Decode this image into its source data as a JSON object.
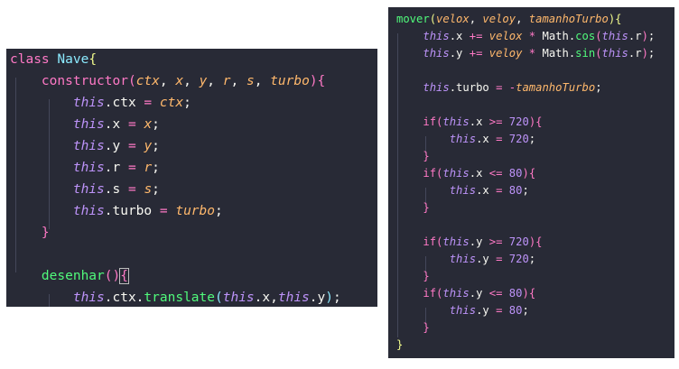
{
  "left_panel": {
    "lines": [
      [
        [
          "kw",
          "class"
        ],
        [
          "pn",
          " "
        ],
        [
          "cls",
          "Nave"
        ],
        [
          "br1",
          "{"
        ]
      ],
      [
        [
          "pn",
          "    "
        ],
        [
          "fnk",
          "constructor"
        ],
        [
          "br2",
          "("
        ],
        [
          "prm",
          "ctx"
        ],
        [
          "pn",
          ", "
        ],
        [
          "prm",
          "x"
        ],
        [
          "pn",
          ", "
        ],
        [
          "prm",
          "y"
        ],
        [
          "pn",
          ", "
        ],
        [
          "prm",
          "r"
        ],
        [
          "pn",
          ", "
        ],
        [
          "prm",
          "s"
        ],
        [
          "pn",
          ", "
        ],
        [
          "prm",
          "turbo"
        ],
        [
          "br2",
          "){"
        ]
      ],
      [
        [
          "pn",
          "        "
        ],
        [
          "ths",
          "this"
        ],
        [
          "pn",
          ".ctx "
        ],
        [
          "op",
          "="
        ],
        [
          "pn",
          " "
        ],
        [
          "prm",
          "ctx"
        ],
        [
          "pn",
          ";"
        ]
      ],
      [
        [
          "pn",
          "        "
        ],
        [
          "ths",
          "this"
        ],
        [
          "pn",
          ".x "
        ],
        [
          "op",
          "="
        ],
        [
          "pn",
          " "
        ],
        [
          "prm",
          "x"
        ],
        [
          "pn",
          ";"
        ]
      ],
      [
        [
          "pn",
          "        "
        ],
        [
          "ths",
          "this"
        ],
        [
          "pn",
          ".y "
        ],
        [
          "op",
          "="
        ],
        [
          "pn",
          " "
        ],
        [
          "prm",
          "y"
        ],
        [
          "pn",
          ";"
        ]
      ],
      [
        [
          "pn",
          "        "
        ],
        [
          "ths",
          "this"
        ],
        [
          "pn",
          ".r "
        ],
        [
          "op",
          "="
        ],
        [
          "pn",
          " "
        ],
        [
          "prm",
          "r"
        ],
        [
          "pn",
          ";"
        ]
      ],
      [
        [
          "pn",
          "        "
        ],
        [
          "ths",
          "this"
        ],
        [
          "pn",
          ".s "
        ],
        [
          "op",
          "="
        ],
        [
          "pn",
          " "
        ],
        [
          "prm",
          "s"
        ],
        [
          "pn",
          ";"
        ]
      ],
      [
        [
          "pn",
          "        "
        ],
        [
          "ths",
          "this"
        ],
        [
          "pn",
          ".turbo "
        ],
        [
          "op",
          "="
        ],
        [
          "pn",
          " "
        ],
        [
          "prm",
          "turbo"
        ],
        [
          "pn",
          ";"
        ]
      ],
      [
        [
          "pn",
          "    "
        ],
        [
          "br2",
          "}"
        ]
      ],
      [
        [
          "pn",
          ""
        ]
      ],
      [
        [
          "pn",
          "    "
        ],
        [
          "fn",
          "desenhar"
        ],
        [
          "br2",
          "()"
        ],
        [
          "br2 match",
          "{"
        ]
      ],
      [
        [
          "pn",
          "        "
        ],
        [
          "ths",
          "this"
        ],
        [
          "pn",
          ".ctx."
        ],
        [
          "fn",
          "translate"
        ],
        [
          "br3",
          "("
        ],
        [
          "ths",
          "this"
        ],
        [
          "pn",
          ".x,"
        ],
        [
          "ths",
          "this"
        ],
        [
          "pn",
          ".y"
        ],
        [
          "br3",
          ")"
        ],
        [
          "pn",
          ";"
        ]
      ]
    ]
  },
  "right_panel": {
    "lines": [
      [
        [
          "fn",
          "mover"
        ],
        [
          "br1",
          "("
        ],
        [
          "prm",
          "velox"
        ],
        [
          "pn",
          ", "
        ],
        [
          "prm",
          "veloy"
        ],
        [
          "pn",
          ", "
        ],
        [
          "prm",
          "tamanhoTurbo"
        ],
        [
          "br1",
          "){"
        ]
      ],
      [
        [
          "pn",
          "    "
        ],
        [
          "ths",
          "this"
        ],
        [
          "pn",
          ".x "
        ],
        [
          "op",
          "+="
        ],
        [
          "pn",
          " "
        ],
        [
          "prm",
          "velox"
        ],
        [
          "pn",
          " "
        ],
        [
          "op",
          "*"
        ],
        [
          "pn",
          " Math."
        ],
        [
          "fn",
          "cos"
        ],
        [
          "br2",
          "("
        ],
        [
          "ths",
          "this"
        ],
        [
          "pn",
          ".r"
        ],
        [
          "br2",
          ")"
        ],
        [
          "pn",
          ";"
        ]
      ],
      [
        [
          "pn",
          "    "
        ],
        [
          "ths",
          "this"
        ],
        [
          "pn",
          ".y "
        ],
        [
          "op",
          "+="
        ],
        [
          "pn",
          " "
        ],
        [
          "prm",
          "veloy"
        ],
        [
          "pn",
          " "
        ],
        [
          "op",
          "*"
        ],
        [
          "pn",
          " Math."
        ],
        [
          "fn",
          "sin"
        ],
        [
          "br2",
          "("
        ],
        [
          "ths",
          "this"
        ],
        [
          "pn",
          ".r"
        ],
        [
          "br2",
          ")"
        ],
        [
          "pn",
          ";"
        ]
      ],
      [
        [
          "pn",
          ""
        ]
      ],
      [
        [
          "pn",
          "    "
        ],
        [
          "ths",
          "this"
        ],
        [
          "pn",
          ".turbo "
        ],
        [
          "op",
          "="
        ],
        [
          "pn",
          " "
        ],
        [
          "op",
          "-"
        ],
        [
          "prm",
          "tamanhoTurbo"
        ],
        [
          "pn",
          ";"
        ]
      ],
      [
        [
          "pn",
          ""
        ]
      ],
      [
        [
          "pn",
          "    "
        ],
        [
          "kw",
          "if"
        ],
        [
          "br2",
          "("
        ],
        [
          "ths",
          "this"
        ],
        [
          "pn",
          ".x "
        ],
        [
          "op",
          ">="
        ],
        [
          "pn",
          " "
        ],
        [
          "num",
          "720"
        ],
        [
          "br2",
          "){"
        ]
      ],
      [
        [
          "pn",
          "        "
        ],
        [
          "ths",
          "this"
        ],
        [
          "pn",
          ".x "
        ],
        [
          "op",
          "="
        ],
        [
          "pn",
          " "
        ],
        [
          "num",
          "720"
        ],
        [
          "pn",
          ";"
        ]
      ],
      [
        [
          "pn",
          "    "
        ],
        [
          "br2",
          "}"
        ]
      ],
      [
        [
          "pn",
          "    "
        ],
        [
          "kw",
          "if"
        ],
        [
          "br2",
          "("
        ],
        [
          "ths",
          "this"
        ],
        [
          "pn",
          ".x "
        ],
        [
          "op",
          "<="
        ],
        [
          "pn",
          " "
        ],
        [
          "num",
          "80"
        ],
        [
          "br2",
          "){"
        ]
      ],
      [
        [
          "pn",
          "        "
        ],
        [
          "ths",
          "this"
        ],
        [
          "pn",
          ".x "
        ],
        [
          "op",
          "="
        ],
        [
          "pn",
          " "
        ],
        [
          "num",
          "80"
        ],
        [
          "pn",
          ";"
        ]
      ],
      [
        [
          "pn",
          "    "
        ],
        [
          "br2",
          "}"
        ]
      ],
      [
        [
          "pn",
          ""
        ]
      ],
      [
        [
          "pn",
          "    "
        ],
        [
          "kw",
          "if"
        ],
        [
          "br2",
          "("
        ],
        [
          "ths",
          "this"
        ],
        [
          "pn",
          ".y "
        ],
        [
          "op",
          ">="
        ],
        [
          "pn",
          " "
        ],
        [
          "num",
          "720"
        ],
        [
          "br2",
          "){"
        ]
      ],
      [
        [
          "pn",
          "        "
        ],
        [
          "ths",
          "this"
        ],
        [
          "pn",
          ".y "
        ],
        [
          "op",
          "="
        ],
        [
          "pn",
          " "
        ],
        [
          "num",
          "720"
        ],
        [
          "pn",
          ";"
        ]
      ],
      [
        [
          "pn",
          "    "
        ],
        [
          "br2",
          "}"
        ]
      ],
      [
        [
          "pn",
          "    "
        ],
        [
          "kw",
          "if"
        ],
        [
          "br2",
          "("
        ],
        [
          "ths",
          "this"
        ],
        [
          "pn",
          ".y "
        ],
        [
          "op",
          "<="
        ],
        [
          "pn",
          " "
        ],
        [
          "num",
          "80"
        ],
        [
          "br2",
          "){"
        ]
      ],
      [
        [
          "pn",
          "        "
        ],
        [
          "ths",
          "this"
        ],
        [
          "pn",
          ".y "
        ],
        [
          "op",
          "="
        ],
        [
          "pn",
          " "
        ],
        [
          "num",
          "80"
        ],
        [
          "pn",
          ";"
        ]
      ],
      [
        [
          "pn",
          "    "
        ],
        [
          "br2",
          "}"
        ]
      ],
      [
        [
          "br1",
          "}"
        ]
      ]
    ]
  }
}
